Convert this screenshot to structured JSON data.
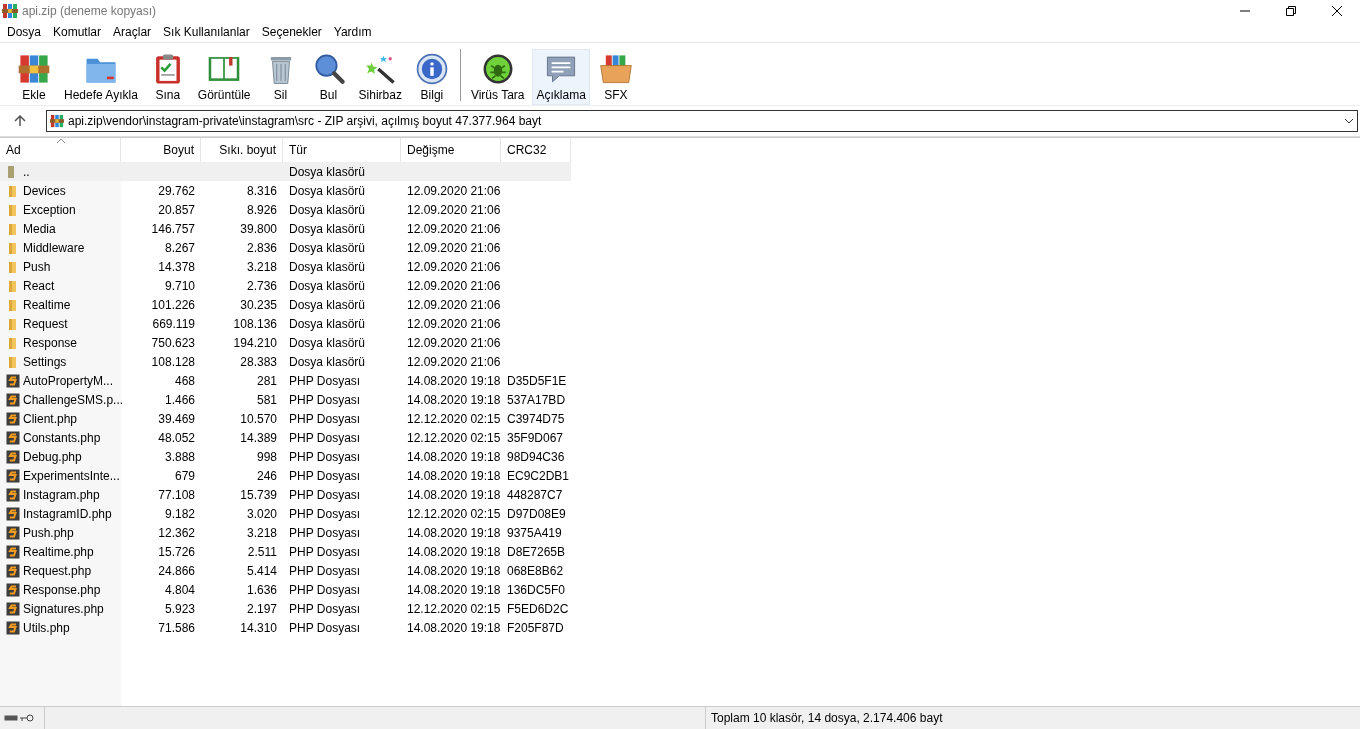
{
  "window": {
    "title": "api.zip (deneme kopyası)"
  },
  "menu": [
    "Dosya",
    "Komutlar",
    "Araçlar",
    "Sık Kullanılanlar",
    "Seçenekler",
    "Yardım"
  ],
  "toolbar": [
    {
      "label": "Ekle",
      "kind": "add",
      "highlighted": false
    },
    {
      "label": "Hedefe Ayıkla",
      "kind": "extract",
      "highlighted": false
    },
    {
      "label": "Sına",
      "kind": "test",
      "highlighted": false
    },
    {
      "label": "Görüntüle",
      "kind": "view",
      "highlighted": false
    },
    {
      "label": "Sil",
      "kind": "delete",
      "highlighted": false
    },
    {
      "label": "Bul",
      "kind": "find",
      "highlighted": false
    },
    {
      "label": "Sihirbaz",
      "kind": "wizard",
      "highlighted": false
    },
    {
      "label": "Bilgi",
      "kind": "info",
      "highlighted": false
    },
    {
      "label": "Virüs Tara",
      "kind": "virus",
      "highlighted": false
    },
    {
      "label": "Açıklama",
      "kind": "comment",
      "highlighted": true
    },
    {
      "label": "SFX",
      "kind": "sfx",
      "highlighted": false
    }
  ],
  "address": {
    "value": "api.zip\\vendor\\instagram-private\\instagram\\src - ZIP arşivi, açılmış boyut 47.377.964 bayt"
  },
  "table": {
    "columns": [
      "Ad",
      "Boyut",
      "Sıkı. boyut",
      "Tür",
      "Değişme",
      "CRC32"
    ],
    "rows": [
      {
        "kind": "parent",
        "selected": true,
        "cells": [
          "..",
          "",
          "",
          "Dosya klasörü",
          "",
          ""
        ]
      },
      {
        "kind": "folder",
        "selected": false,
        "cells": [
          "Devices",
          "29.762",
          "8.316",
          "Dosya klasörü",
          "12.09.2020 21:06",
          ""
        ]
      },
      {
        "kind": "folder",
        "selected": false,
        "cells": [
          "Exception",
          "20.857",
          "8.926",
          "Dosya klasörü",
          "12.09.2020 21:06",
          ""
        ]
      },
      {
        "kind": "folder",
        "selected": false,
        "cells": [
          "Media",
          "146.757",
          "39.800",
          "Dosya klasörü",
          "12.09.2020 21:06",
          ""
        ]
      },
      {
        "kind": "folder",
        "selected": false,
        "cells": [
          "Middleware",
          "8.267",
          "2.836",
          "Dosya klasörü",
          "12.09.2020 21:06",
          ""
        ]
      },
      {
        "kind": "folder",
        "selected": false,
        "cells": [
          "Push",
          "14.378",
          "3.218",
          "Dosya klasörü",
          "12.09.2020 21:06",
          ""
        ]
      },
      {
        "kind": "folder",
        "selected": false,
        "cells": [
          "React",
          "9.710",
          "2.736",
          "Dosya klasörü",
          "12.09.2020 21:06",
          ""
        ]
      },
      {
        "kind": "folder",
        "selected": false,
        "cells": [
          "Realtime",
          "101.226",
          "30.235",
          "Dosya klasörü",
          "12.09.2020 21:06",
          ""
        ]
      },
      {
        "kind": "folder",
        "selected": false,
        "cells": [
          "Request",
          "669.119",
          "108.136",
          "Dosya klasörü",
          "12.09.2020 21:06",
          ""
        ]
      },
      {
        "kind": "folder",
        "selected": false,
        "cells": [
          "Response",
          "750.623",
          "194.210",
          "Dosya klasörü",
          "12.09.2020 21:06",
          ""
        ]
      },
      {
        "kind": "folder",
        "selected": false,
        "cells": [
          "Settings",
          "108.128",
          "28.383",
          "Dosya klasörü",
          "12.09.2020 21:06",
          ""
        ]
      },
      {
        "kind": "php",
        "selected": false,
        "cells": [
          "AutoPropertyM...",
          "468",
          "281",
          "PHP Dosyası",
          "14.08.2020 19:18",
          "D35D5F1E"
        ]
      },
      {
        "kind": "php",
        "selected": false,
        "cells": [
          "ChallengeSMS.p...",
          "1.466",
          "581",
          "PHP Dosyası",
          "14.08.2020 19:18",
          "537A17BD"
        ]
      },
      {
        "kind": "php",
        "selected": false,
        "cells": [
          "Client.php",
          "39.469",
          "10.570",
          "PHP Dosyası",
          "12.12.2020 02:15",
          "C3974D75"
        ]
      },
      {
        "kind": "php",
        "selected": false,
        "cells": [
          "Constants.php",
          "48.052",
          "14.389",
          "PHP Dosyası",
          "12.12.2020 02:15",
          "35F9D067"
        ]
      },
      {
        "kind": "php",
        "selected": false,
        "cells": [
          "Debug.php",
          "3.888",
          "998",
          "PHP Dosyası",
          "14.08.2020 19:18",
          "98D94C36"
        ]
      },
      {
        "kind": "php",
        "selected": false,
        "cells": [
          "ExperimentsInte...",
          "679",
          "246",
          "PHP Dosyası",
          "14.08.2020 19:18",
          "EC9C2DB1"
        ]
      },
      {
        "kind": "php",
        "selected": false,
        "cells": [
          "Instagram.php",
          "77.108",
          "15.739",
          "PHP Dosyası",
          "14.08.2020 19:18",
          "448287C7"
        ]
      },
      {
        "kind": "php",
        "selected": false,
        "cells": [
          "InstagramID.php",
          "9.182",
          "3.020",
          "PHP Dosyası",
          "12.12.2020 02:15",
          "D97D08E9"
        ]
      },
      {
        "kind": "php",
        "selected": false,
        "cells": [
          "Push.php",
          "12.362",
          "3.218",
          "PHP Dosyası",
          "14.08.2020 19:18",
          "9375A419"
        ]
      },
      {
        "kind": "php",
        "selected": false,
        "cells": [
          "Realtime.php",
          "15.726",
          "2.511",
          "PHP Dosyası",
          "14.08.2020 19:18",
          "D8E7265B"
        ]
      },
      {
        "kind": "php",
        "selected": false,
        "cells": [
          "Request.php",
          "24.866",
          "5.414",
          "PHP Dosyası",
          "14.08.2020 19:18",
          "068E8B62"
        ]
      },
      {
        "kind": "php",
        "selected": false,
        "cells": [
          "Response.php",
          "4.804",
          "1.636",
          "PHP Dosyası",
          "14.08.2020 19:18",
          "136DC5F0"
        ]
      },
      {
        "kind": "php",
        "selected": false,
        "cells": [
          "Signatures.php",
          "5.923",
          "2.197",
          "PHP Dosyası",
          "12.12.2020 02:15",
          "F5ED6D2C"
        ]
      },
      {
        "kind": "php",
        "selected": false,
        "cells": [
          "Utils.php",
          "71.586",
          "14.310",
          "PHP Dosyası",
          "14.08.2020 19:18",
          "F205F87D"
        ]
      }
    ]
  },
  "status_bar": {
    "text": "Toplam 10 klasör, 14 dosya, 2.174.406 bayt"
  }
}
